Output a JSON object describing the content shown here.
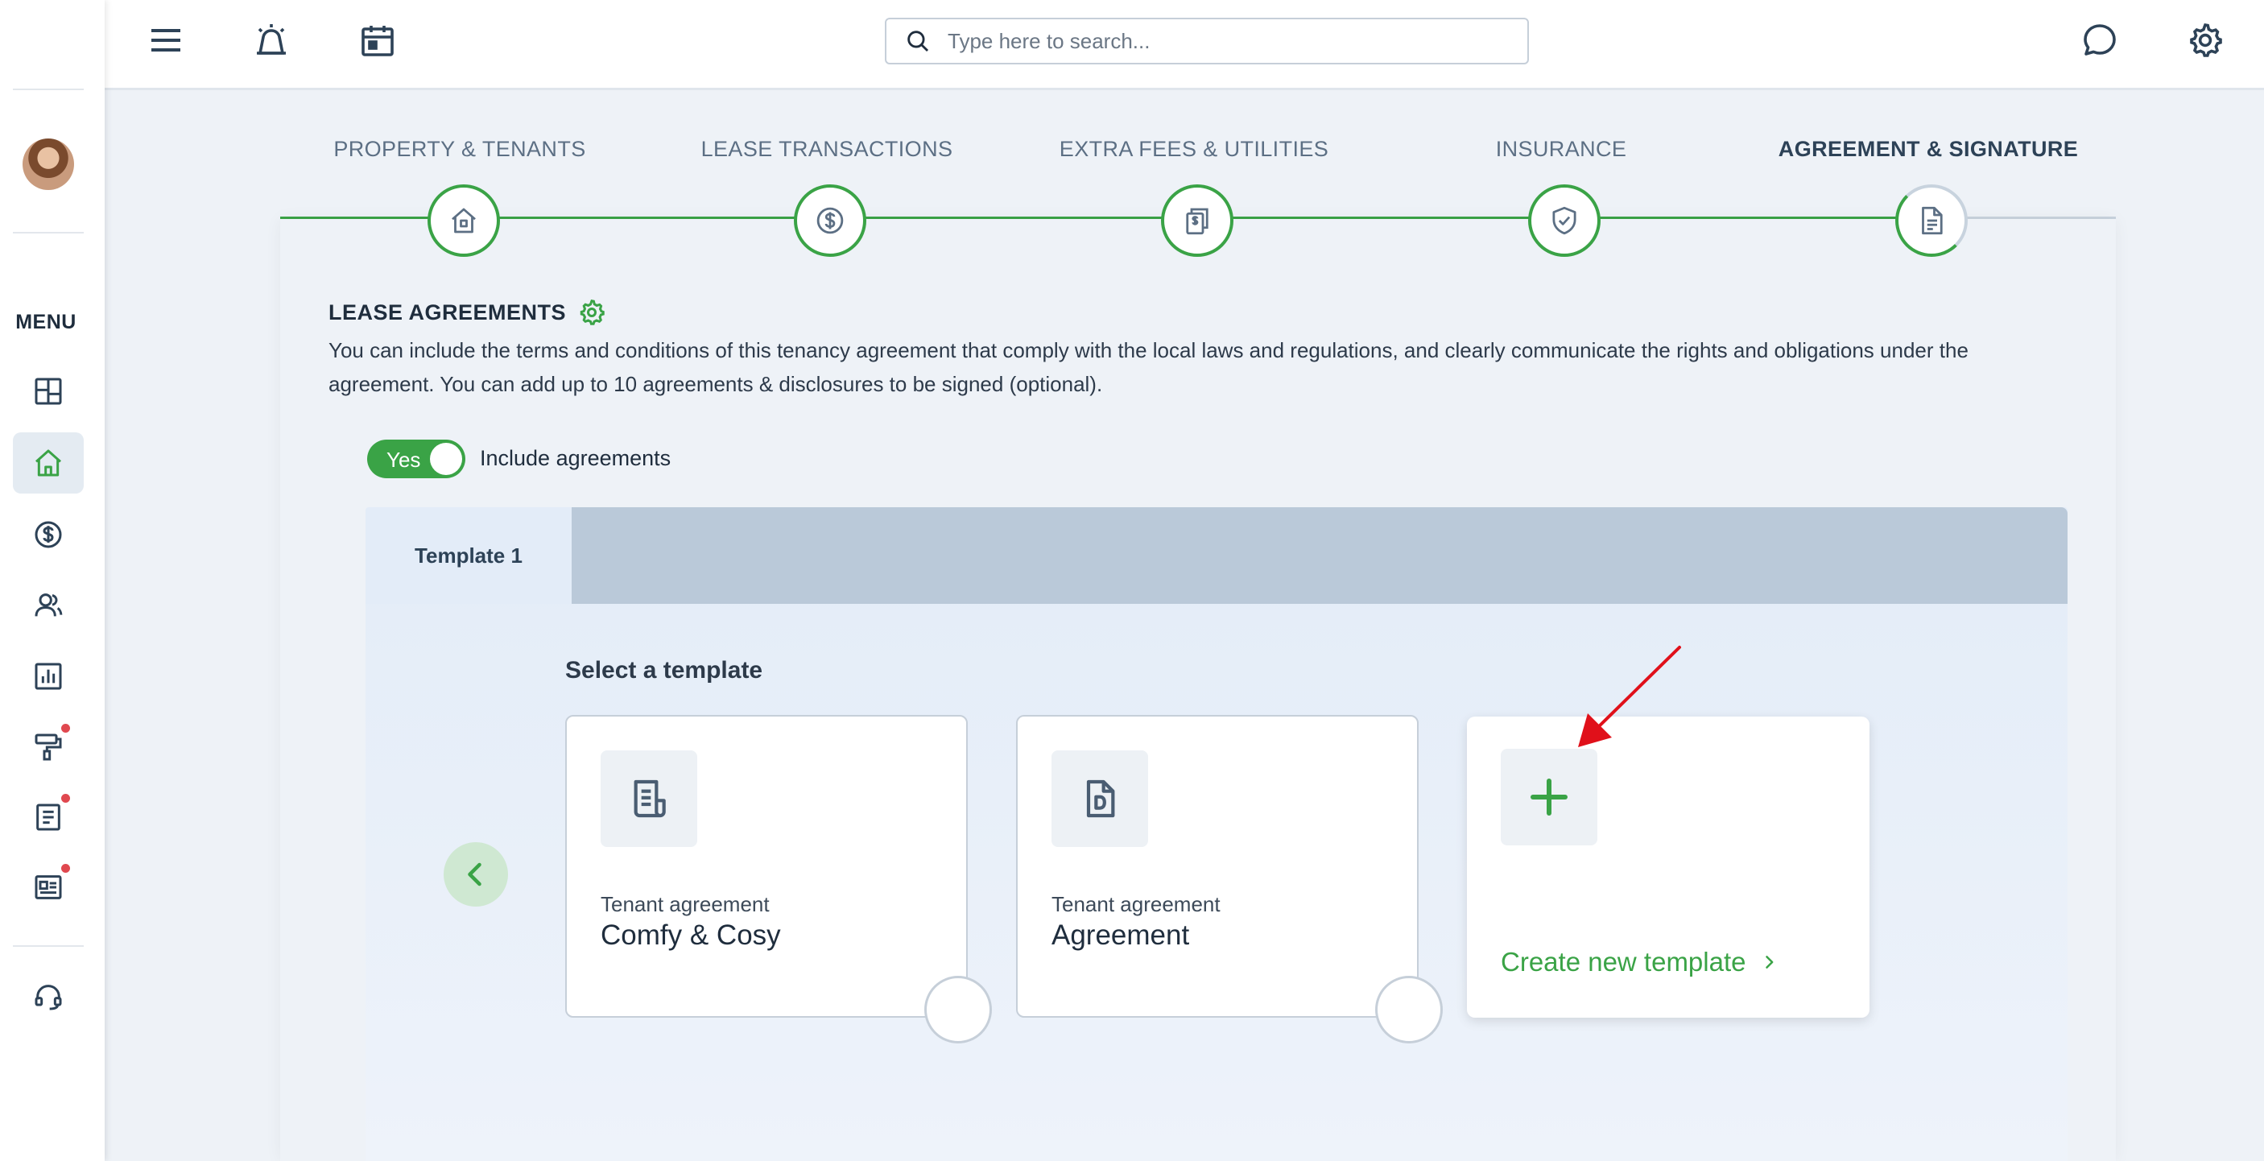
{
  "sidebar": {
    "menu_label": "MENU",
    "items": [
      {
        "icon": "dashboard-icon"
      },
      {
        "icon": "home-icon",
        "active": true
      },
      {
        "icon": "dollar-icon"
      },
      {
        "icon": "users-icon"
      },
      {
        "icon": "reports-icon"
      },
      {
        "icon": "maintenance-icon",
        "badge": true
      },
      {
        "icon": "documents-icon",
        "badge": true
      },
      {
        "icon": "listings-icon",
        "badge": true
      }
    ],
    "support_icon": "headset-icon"
  },
  "topbar": {
    "search_placeholder": "Type here to search..."
  },
  "stepper": {
    "steps": [
      {
        "label": "PROPERTY & TENANTS",
        "icon": "house-icon",
        "status": "complete"
      },
      {
        "label": "LEASE TRANSACTIONS",
        "icon": "dollar-icon",
        "status": "complete"
      },
      {
        "label": "EXTRA FEES & UTILITIES",
        "icon": "fees-icon",
        "status": "complete"
      },
      {
        "label": "INSURANCE",
        "icon": "shield-icon",
        "status": "complete"
      },
      {
        "label": "AGREEMENT & SIGNATURE",
        "icon": "document-icon",
        "status": "current"
      }
    ]
  },
  "agreements": {
    "title": "LEASE AGREEMENTS",
    "description": "You can include the terms and conditions of this tenancy agreement that comply with the local laws and regulations, and clearly communicate the rights and obligations under the agreement. You can add up to 10 agreements & disclosures to be signed (optional).",
    "toggle_value": "Yes",
    "toggle_label": "Include agreements",
    "tabs": [
      "Template 1"
    ],
    "select_title": "Select a template",
    "templates": [
      {
        "subtitle": "Tenant agreement",
        "name": "Comfy & Cosy",
        "icon": "document-lines-icon"
      },
      {
        "subtitle": "Tenant agreement",
        "name": "Agreement",
        "icon": "document-d-icon"
      }
    ],
    "create_label": "Create new template"
  },
  "colors": {
    "accent": "#3aa346",
    "tab_bar": "#bac9d9",
    "badge": "#e0484f",
    "annotation_arrow": "#e0101a"
  }
}
